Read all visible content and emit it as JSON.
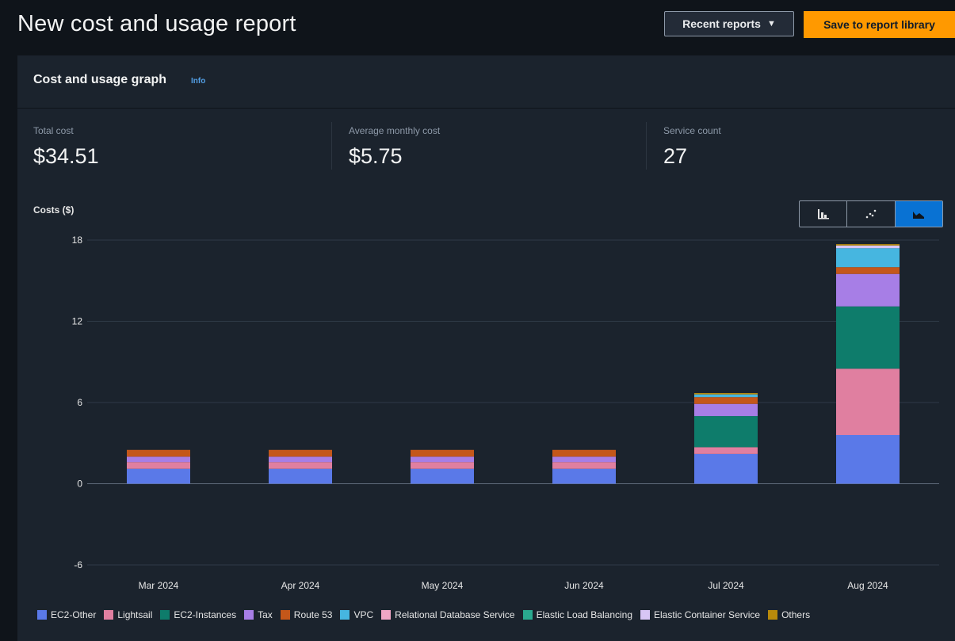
{
  "header": {
    "title": "New cost and usage report",
    "recent_reports_label": "Recent reports",
    "save_label": "Save to report library"
  },
  "panel": {
    "title": "Cost and usage graph",
    "info_label": "Info"
  },
  "kpis": [
    {
      "label": "Total cost",
      "value": "$34.51"
    },
    {
      "label": "Average monthly cost",
      "value": "$5.75"
    },
    {
      "label": "Service count",
      "value": "27"
    }
  ],
  "chart_controls": {
    "options": [
      "bar-chart-icon",
      "scatter-chart-icon",
      "stacked-area-chart-icon"
    ],
    "selected": "stacked-area-chart-icon"
  },
  "chart_data": {
    "type": "bar",
    "stacked": true,
    "ylabel": "Costs ($)",
    "ylim": [
      -6,
      18
    ],
    "yticks": [
      18,
      12,
      6,
      0,
      -6
    ],
    "grid": true,
    "legend_position": "bottom",
    "categories": [
      "Mar 2024",
      "Apr 2024",
      "May 2024",
      "Jun 2024",
      "Jul 2024",
      "Aug 2024"
    ],
    "series": [
      {
        "name": "EC2-Other",
        "color": "#688ae8",
        "values": [
          1.1,
          1.1,
          1.1,
          1.1,
          2.2,
          3.6
        ]
      },
      {
        "name": "Lightsail",
        "color": "#c33d69",
        "values": [
          0.5,
          0.5,
          0.5,
          0.5,
          0.5,
          4.9
        ]
      },
      {
        "name": "EC2-Instances",
        "color": "#2ea597",
        "values": [
          0.0,
          0.0,
          0.0,
          0.0,
          2.3,
          4.6
        ]
      },
      {
        "name": "Tax",
        "color": "#8456ce",
        "values": [
          0.4,
          0.4,
          0.4,
          0.4,
          0.9,
          2.4
        ]
      },
      {
        "name": "Route 53",
        "color": "#e07941",
        "values": [
          0.5,
          0.5,
          0.5,
          0.5,
          0.5,
          0.5
        ]
      },
      {
        "name": "VPC",
        "color": "#3759ce",
        "values": [
          0.0,
          0.0,
          0.0,
          0.0,
          0.2,
          1.4
        ]
      },
      {
        "name": "Relational Database Service",
        "color": "#962249",
        "values": [
          0.0,
          0.0,
          0.0,
          0.0,
          0.0,
          0.0
        ]
      },
      {
        "name": "Elastic Load Balancing",
        "color": "#096f64",
        "values": [
          0.0,
          0.0,
          0.0,
          0.0,
          0.0,
          0.0
        ]
      },
      {
        "name": "Elastic Container Service",
        "color": "#6237a7",
        "values": [
          0.0,
          0.0,
          0.0,
          0.0,
          0.0,
          0.2
        ]
      },
      {
        "name": "Others",
        "color": "#a84401",
        "values": [
          0.0,
          0.0,
          0.0,
          0.0,
          0.1,
          0.1
        ]
      }
    ]
  },
  "display_colors": {
    "EC2-Other": "#5a79e8",
    "Lightsail": "#e07fa0",
    "EC2-Instances": "#0e7c6b",
    "Tax": "#a77ee6",
    "Route 53": "#c4571a",
    "VPC": "#46b6e0",
    "Relational Database Service": "#f0a6c5",
    "Elastic Load Balancing": "#2aa98f",
    "Elastic Container Service": "#d8c6f5",
    "Others": "#b88a0b"
  }
}
